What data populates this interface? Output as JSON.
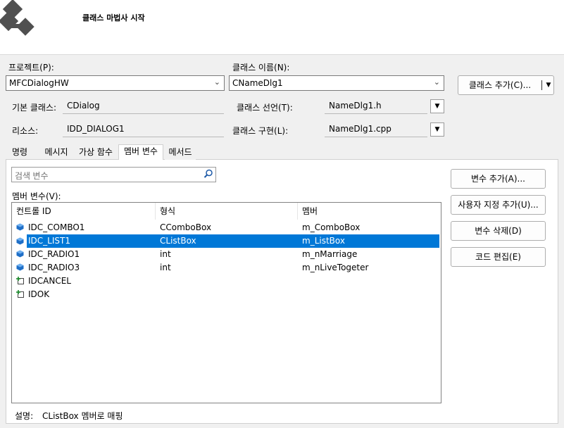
{
  "window": {
    "title": "클래스 마법사 시작"
  },
  "project": {
    "label": "프로젝트(P):",
    "value": "MFCDialogHW"
  },
  "class_name": {
    "label": "클래스 이름(N):",
    "value": "CNameDlg1"
  },
  "add_class_button": {
    "label": "클래스 추가(C)..."
  },
  "base_class": {
    "label": "기본 클래스:",
    "value": "CDialog"
  },
  "resource": {
    "label": "리소스:",
    "value": "IDD_DIALOG1"
  },
  "class_declaration": {
    "label": "클래스 선언(T):",
    "value": "NameDlg1.h"
  },
  "class_implementation": {
    "label": "클래스 구현(L):",
    "value": "NameDlg1.cpp"
  },
  "tabs": [
    {
      "label": "명령"
    },
    {
      "label": "메시지"
    },
    {
      "label": "가상 함수"
    },
    {
      "label": "멤버 변수"
    },
    {
      "label": "메서드"
    }
  ],
  "active_tab": "멤버 변수",
  "search": {
    "placeholder": "검색 변수"
  },
  "member_variables": {
    "label": "멤버 변수(V):",
    "columns": [
      "컨트롤 ID",
      "형식",
      "멤버"
    ],
    "rows": [
      {
        "id": "IDC_COMBO1",
        "type": "CComboBox",
        "member": "m_ComboBox",
        "icon": "variable-cube-icon",
        "selected": false
      },
      {
        "id": "IDC_LIST1",
        "type": "CListBox",
        "member": "m_ListBox",
        "icon": "variable-cube-icon",
        "selected": true
      },
      {
        "id": "IDC_RADIO1",
        "type": "int",
        "member": "m_nMarriage",
        "icon": "variable-cube-icon",
        "selected": false
      },
      {
        "id": "IDC_RADIO3",
        "type": "int",
        "member": "m_nLiveTogeter",
        "icon": "variable-cube-icon",
        "selected": false
      },
      {
        "id": "IDCANCEL",
        "type": "",
        "member": "",
        "icon": "control-add-icon",
        "selected": false
      },
      {
        "id": "IDOK",
        "type": "",
        "member": "",
        "icon": "control-add-icon",
        "selected": false
      }
    ]
  },
  "buttons": {
    "add_variable": "변수 추가(A)...",
    "add_custom": "사용자 지정 추가(U)...",
    "delete_variable": "변수 삭제(D)",
    "edit_code": "코드 편집(E)"
  },
  "description": {
    "label": "설명:",
    "value": "CListBox 멤버로 매핑"
  },
  "colors": {
    "accent": "#0078d7",
    "header_bg": "#ffffff",
    "window_bg": "#f0f0f0"
  }
}
